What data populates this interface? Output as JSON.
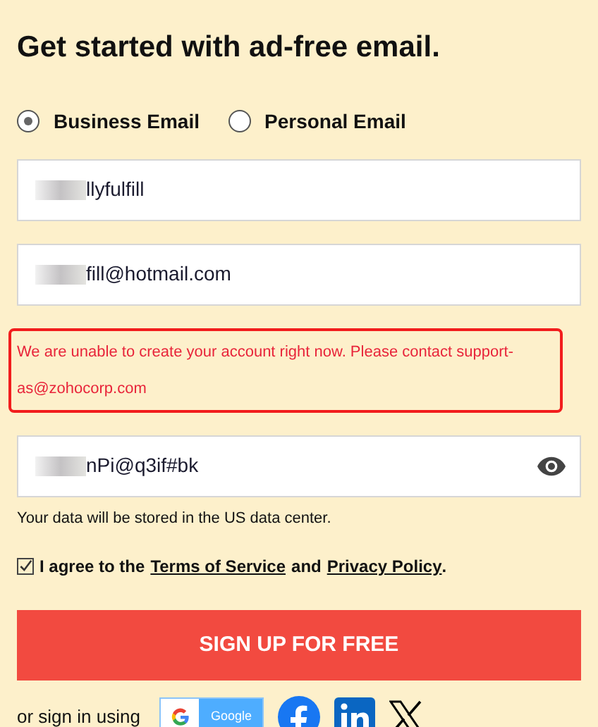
{
  "heading": "Get started with ad-free email.",
  "account_types": [
    {
      "label": "Business Email",
      "selected": true
    },
    {
      "label": "Personal Email",
      "selected": false
    }
  ],
  "fields": [
    {
      "kind": "text",
      "value": "llyfulfill",
      "redacted": true
    },
    {
      "kind": "text",
      "value": "fill@hotmail.com",
      "redacted": true
    },
    {
      "kind": "error",
      "value": "We are unable to create your account right now. Please contact support-as@zohocorp.com"
    },
    {
      "kind": "password",
      "value": "nPi@q3if#bk",
      "redacted": true
    }
  ],
  "data_center_note": "Your data will be stored in the US data center.",
  "agreement": {
    "checked": true,
    "prefix": "I agree to the",
    "terms": "Terms of Service",
    "middle": "and",
    "privacy": "Privacy Policy",
    "suffix": "."
  },
  "submit": "SIGN UP FOR FREE",
  "alt_signin": {
    "label": "or sign in using",
    "google": "Google"
  }
}
